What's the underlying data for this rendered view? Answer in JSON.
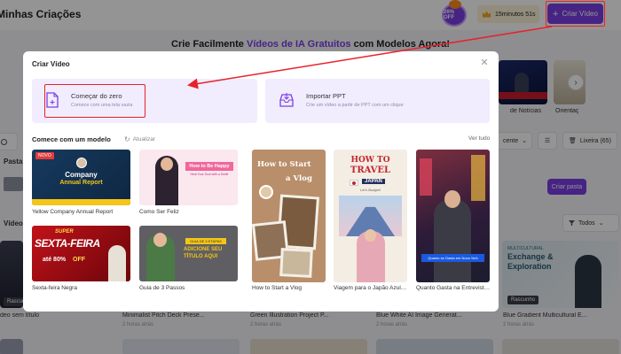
{
  "header": {
    "title": "Minhas Criações",
    "off_badge": "26% OFF",
    "minutes": "15minutos 51s",
    "create_button": "Criar Vídeo"
  },
  "promo": {
    "prefix": "Crie Facilmente ",
    "accent": "Vídeos de IA Gratuitos",
    "suffix": " com Modelos Agora!"
  },
  "background": {
    "thumb_caption_1": "de Notícias",
    "thumb_caption_2": "Orientaç",
    "section_drafts": "Pastas",
    "section_videos": "Vídeos",
    "sort_label": "cente",
    "trash_label": "Lixeira (65)",
    "create_folder": "Criar pasta",
    "filter_label": "Todos",
    "draft_badge": "Rascunho",
    "video_titles": [
      "deo sem título",
      "Minimalist Pitch Deck Prese...",
      "Green Illustration Project P...",
      "Blue White AI Image Generat...",
      "Blue Gradient Multicultural E..."
    ],
    "video_times": [
      "2 horas atrás",
      "2 horas atrás",
      "2 horas atrás",
      "2 horas atrás"
    ],
    "exchange_title_1": "MULTICULTURAL",
    "exchange_title_2": "Exchange &",
    "exchange_title_3": "Exploration"
  },
  "modal": {
    "title": "Criar Vídeo",
    "options": [
      {
        "title": "Começar do zero",
        "subtitle": "Comece com uma tela vazia"
      },
      {
        "title": "Importar PPT",
        "subtitle": "Crie um vídeo a partir de PPT com um clique"
      }
    ],
    "templates_heading": "Comece com um modelo",
    "refresh": "Atualizar",
    "see_all": "Ver tudo",
    "templates": [
      {
        "caption": "Yellow Company Annual Report",
        "badge": "NOVO",
        "line1": "Company",
        "line2": "Annual Report"
      },
      {
        "caption": "Como Ser Feliz",
        "line1": "How to Be Happy",
        "line2": "Heal Your Soul with a Smile"
      },
      {
        "caption": "Sexta-feira Negra",
        "line1": "SEXTA-FEIRA",
        "line2": "OFF",
        "line3": "até 80%",
        "tag": "SUPER"
      },
      {
        "caption": "Guia de 3 Passos",
        "line1": "GUIA DE 3 ETAPAS",
        "line2": "ADICIONE SEU",
        "line3": "TÍTULO AQUI"
      },
      {
        "caption": "How to Start a Vlog",
        "line1": "How to Start",
        "line2": "a Vlog"
      },
      {
        "caption": "Viagem para o Japão Azul e...",
        "line1": "HOW TO",
        "line2": "TRAVEL",
        "line3": "JAPAN",
        "line4": "Let's Budget!"
      },
      {
        "caption": "Quanto Gasta na Entrevista...",
        "line1": "Quanto se Gasta em Nova York"
      }
    ]
  },
  "colors": {
    "accent": "#7b3fe4",
    "highlight": "#e8222a",
    "option_bg": "#f1ecfe"
  }
}
